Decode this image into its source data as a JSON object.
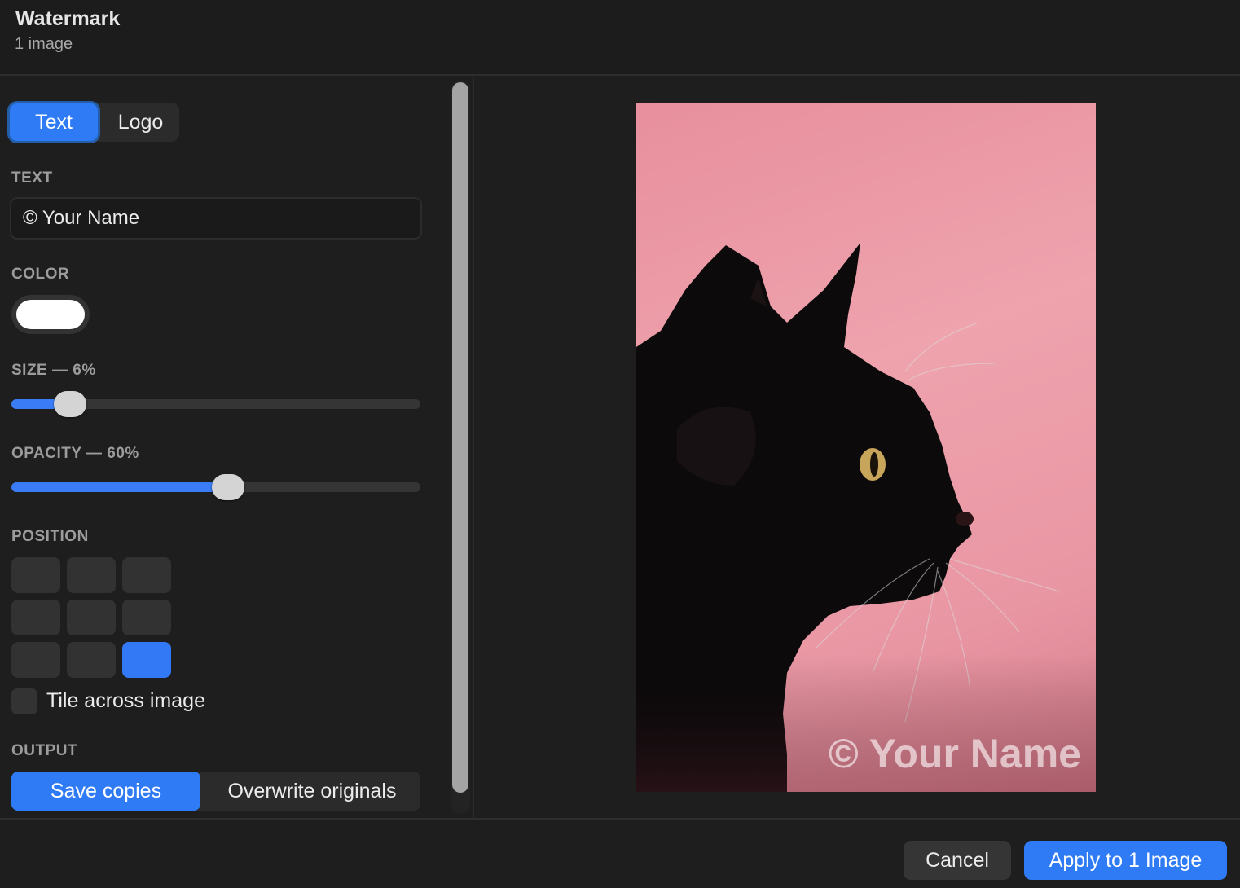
{
  "window": {
    "title": "Watermark",
    "subtitle": "1 image"
  },
  "mode_tabs": {
    "text": "Text",
    "logo": "Logo",
    "selected": "text"
  },
  "text_section": {
    "label": "TEXT",
    "value": "© Your Name"
  },
  "color_section": {
    "label": "COLOR",
    "value": "#ffffff"
  },
  "size_section": {
    "label": "SIZE — 6%",
    "value": 0.06
  },
  "opacity_section": {
    "label": "OPACITY — 60%",
    "value": 0.6
  },
  "position_section": {
    "label": "POSITION",
    "selected": "bottom-right"
  },
  "tile": {
    "label": "Tile across image",
    "checked": false
  },
  "output_section": {
    "label": "OUTPUT",
    "save_copies": "Save copies",
    "overwrite": "Overwrite originals",
    "selected": "save_copies"
  },
  "preview": {
    "watermark": "© Your Name"
  },
  "footer": {
    "cancel": "Cancel",
    "apply": "Apply to 1 Image"
  },
  "colors": {
    "accent": "#2f7bf5",
    "background": "#1e1e1e"
  }
}
